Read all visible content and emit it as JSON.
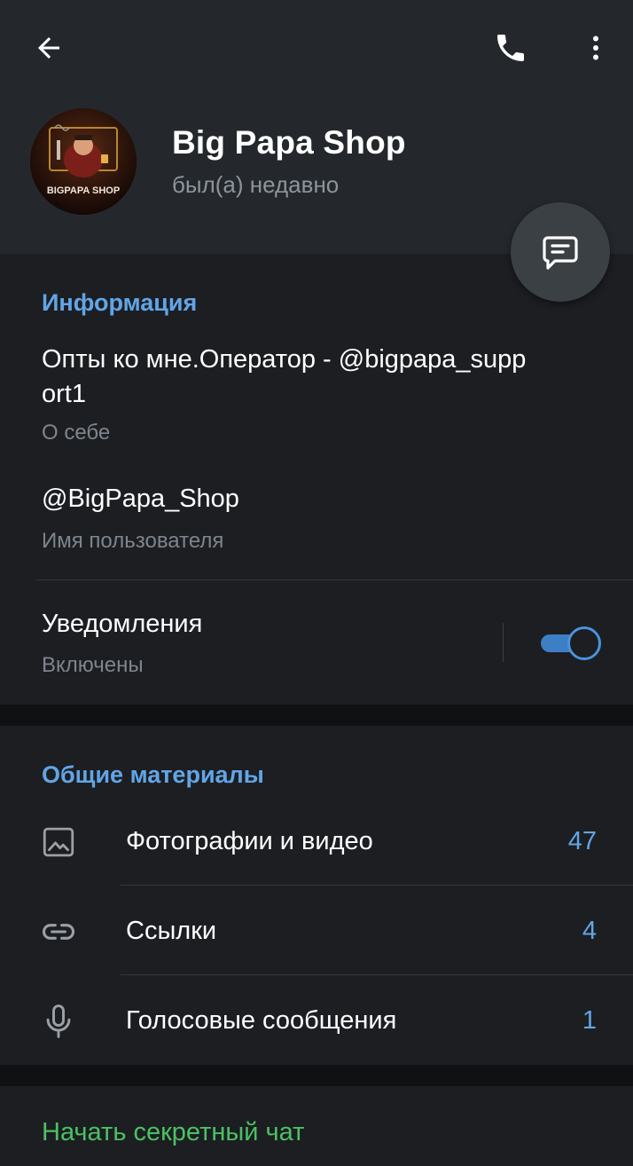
{
  "header": {
    "back_icon": "arrow-left-icon",
    "call_icon": "phone-icon",
    "more_icon": "more-vertical-icon",
    "name": "Big Papa Shop",
    "status": "был(а) недавно",
    "avatar_text": "BIGPAPA SHOP",
    "fab_icon": "message-icon"
  },
  "info": {
    "title": "Информация",
    "bio": "Опты ко мне.Оператор - @bigpapa_support1",
    "bio_label": "О себе",
    "username": "@BigPapa_Shop",
    "username_label": "Имя пользователя",
    "notifications_title": "Уведомления",
    "notifications_label": "Включены",
    "notifications_enabled": true
  },
  "media": {
    "title": "Общие материалы",
    "items": [
      {
        "label": "Фотографии и видео",
        "count": "47",
        "icon": "image-icon"
      },
      {
        "label": "Ссылки",
        "count": "4",
        "icon": "link-icon"
      },
      {
        "label": "Голосовые сообщения",
        "count": "1",
        "icon": "microphone-icon"
      }
    ]
  },
  "secret": {
    "label": "Начать секретный чат"
  },
  "colors": {
    "accent": "#62a5e6",
    "green": "#4bc163",
    "header_bg": "#24282c",
    "section_bg": "#1c1e22",
    "page_bg": "#101113"
  }
}
